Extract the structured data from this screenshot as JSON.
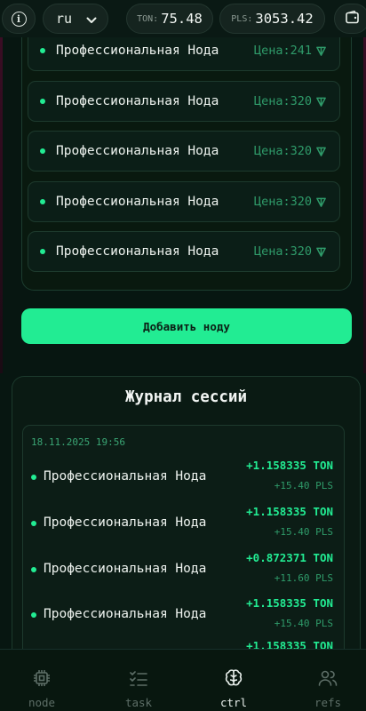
{
  "colors": {
    "accent": "#22ec93",
    "bg": "#071611"
  },
  "header": {
    "info_icon": "info-icon",
    "language": "ru",
    "ton_label": "TON:",
    "ton_value": "75.48",
    "pls_label": "PLS:",
    "pls_value": "3053.42",
    "wallet_icon": "wallet-icon"
  },
  "nodes": [
    {
      "name": "Профессиональная Нода",
      "price": "Цена:241"
    },
    {
      "name": "Профессиональная Нода",
      "price": "Цена:320"
    },
    {
      "name": "Профессиональная Нода",
      "price": "Цена:320"
    },
    {
      "name": "Профессиональная Нода",
      "price": "Цена:320"
    },
    {
      "name": "Профессиональная Нода",
      "price": "Цена:320"
    }
  ],
  "add_node_label": "Добавить ноду",
  "journal": {
    "title": "Журнал сессий",
    "date": "18.11.2025 19:56",
    "entries": [
      {
        "name": "Профессиональная Нода",
        "ton": "+1.158335 TON",
        "pls": "+15.40 PLS"
      },
      {
        "name": "Профессиональная Нода",
        "ton": "+1.158335 TON",
        "pls": "+15.40 PLS"
      },
      {
        "name": "Профессиональная Нода",
        "ton": "+0.872371 TON",
        "pls": "+11.60 PLS"
      },
      {
        "name": "Профессиональная Нода",
        "ton": "+1.158335 TON",
        "pls": "+15.40 PLS"
      },
      {
        "name": "",
        "ton": "+1.158335 TON",
        "pls": ""
      }
    ]
  },
  "nav": [
    {
      "label": "node",
      "icon": "chip-icon",
      "active": false
    },
    {
      "label": "task",
      "icon": "checklist-icon",
      "active": false
    },
    {
      "label": "ctrl",
      "icon": "brain-icon",
      "active": true
    },
    {
      "label": "refs",
      "icon": "users-icon",
      "active": false
    }
  ]
}
